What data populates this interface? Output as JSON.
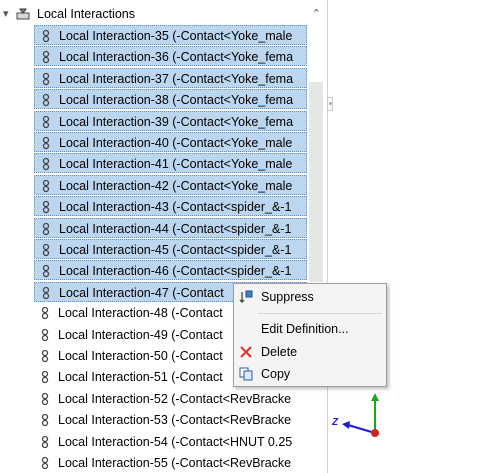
{
  "tree": {
    "header_label": "Local Interactions",
    "items": [
      {
        "label": "Local Interaction-35 (-Contact<Yoke_male",
        "selected": true
      },
      {
        "label": "Local Interaction-36 (-Contact<Yoke_fema",
        "selected": true
      },
      {
        "label": "Local Interaction-37 (-Contact<Yoke_fema",
        "selected": true
      },
      {
        "label": "Local Interaction-38 (-Contact<Yoke_fema",
        "selected": true
      },
      {
        "label": "Local Interaction-39 (-Contact<Yoke_fema",
        "selected": true
      },
      {
        "label": "Local Interaction-40 (-Contact<Yoke_male",
        "selected": true
      },
      {
        "label": "Local Interaction-41 (-Contact<Yoke_male",
        "selected": true
      },
      {
        "label": "Local Interaction-42 (-Contact<Yoke_male",
        "selected": true
      },
      {
        "label": "Local Interaction-43 (-Contact<spider_&-1",
        "selected": true
      },
      {
        "label": "Local Interaction-44 (-Contact<spider_&-1",
        "selected": true
      },
      {
        "label": "Local Interaction-45 (-Contact<spider_&-1",
        "selected": true
      },
      {
        "label": "Local Interaction-46 (-Contact<spider_&-1",
        "selected": true
      },
      {
        "label": "Local Interaction-47 (-Contact",
        "selected": true
      },
      {
        "label": "Local Interaction-48 (-Contact",
        "selected": false
      },
      {
        "label": "Local Interaction-49 (-Contact",
        "selected": false
      },
      {
        "label": "Local Interaction-50 (-Contact",
        "selected": false
      },
      {
        "label": "Local Interaction-51 (-Contact",
        "selected": false
      },
      {
        "label": "Local Interaction-52 (-Contact<RevBracke",
        "selected": false
      },
      {
        "label": "Local Interaction-53 (-Contact<RevBracke",
        "selected": false
      },
      {
        "label": "Local Interaction-54 (-Contact<HNUT 0.25",
        "selected": false
      },
      {
        "label": "Local Interaction-55 (-Contact<RevBracke",
        "selected": false
      }
    ]
  },
  "context_menu": {
    "items": [
      {
        "label": "Suppress",
        "icon": "suppress-icon"
      },
      {
        "label": "Edit Definition...",
        "icon": "none"
      },
      {
        "label": "Delete",
        "icon": "delete-x-icon"
      },
      {
        "label": "Copy",
        "icon": "copy-icon"
      }
    ]
  },
  "triad": {
    "z_label": "Z"
  },
  "colors": {
    "selection": "#bcd6f0",
    "highlight": "#f2f21a",
    "delete": "#e03030"
  }
}
